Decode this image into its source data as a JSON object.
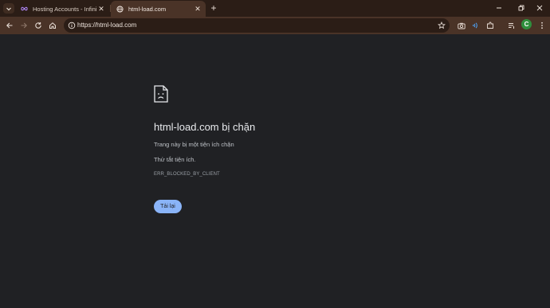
{
  "tabs": [
    {
      "title": "Hosting Accounts - InfinityFree",
      "favicon": "infinity-icon",
      "active": false
    },
    {
      "title": "html-load.com",
      "favicon": "globe-icon",
      "active": true
    }
  ],
  "address_bar": {
    "url": "https://html-load.com"
  },
  "error_page": {
    "title": "html-load.com bị chặn",
    "description": "Trang này bị một tiện ích chặn",
    "hint": "Thử tắt tiện ích.",
    "code": "ERR_BLOCKED_BY_CLIENT",
    "reload_label": "Tải lại"
  },
  "profile": {
    "initial": "C"
  },
  "colors": {
    "tabstrip": "#2b1d16",
    "toolbar": "#4a3327",
    "page_background": "#202124",
    "button_accent": "#8ab4f8"
  }
}
